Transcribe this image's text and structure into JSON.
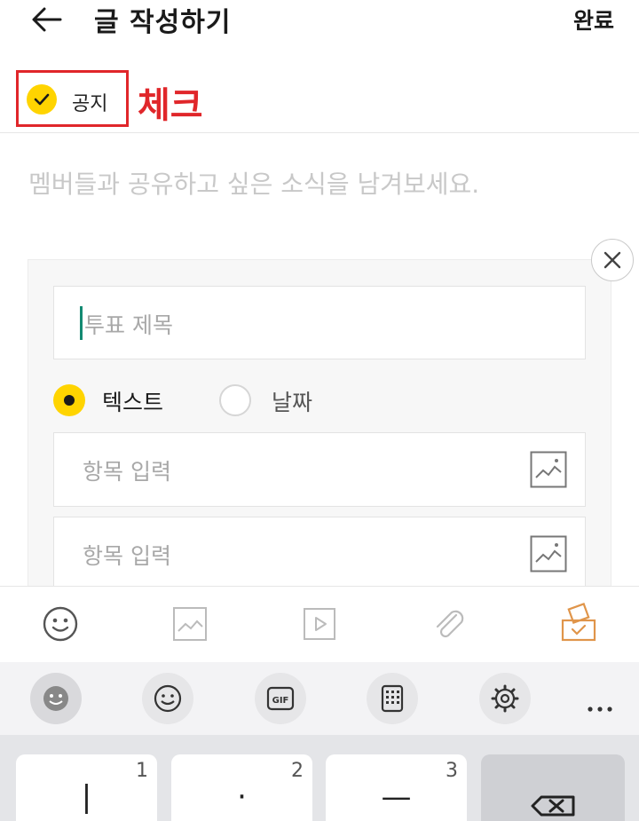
{
  "header": {
    "title": "글 작성하기",
    "done_label": "완료",
    "back_icon": "arrow-left-icon"
  },
  "notice": {
    "label": "공지",
    "checked": true,
    "annotation": "체크",
    "annotation_color": "#e0262a",
    "check_color": "#ffd400"
  },
  "composer": {
    "body_placeholder": "멤버들과 공유하고 싶은 소식을 남겨보세요."
  },
  "poll": {
    "title_placeholder": "투표 제목",
    "type_options": [
      {
        "label": "텍스트",
        "selected": true
      },
      {
        "label": "날짜",
        "selected": false
      }
    ],
    "items": [
      {
        "placeholder": "항목 입력",
        "icon": "image-icon"
      },
      {
        "placeholder": "항목 입력",
        "icon": "image-icon"
      }
    ],
    "accent_color": "#ffd400"
  },
  "toolbar": {
    "tools": [
      "emoji-icon",
      "image-icon",
      "video-icon",
      "attachment-icon",
      "poll-icon"
    ],
    "active_tool_color": "#e0954a"
  },
  "keyboard_bar": {
    "buttons": [
      "sticker-icon",
      "emoji-icon",
      "gif-icon",
      "keypad-icon",
      "settings-icon",
      "more-icon"
    ],
    "gif_label": "GIF"
  },
  "keyboard": {
    "keys": [
      {
        "number": "1",
        "glyph": "|"
      },
      {
        "number": "2",
        "glyph": "·"
      },
      {
        "number": "3",
        "glyph": "—"
      }
    ],
    "backspace_icon": "backspace-icon"
  }
}
